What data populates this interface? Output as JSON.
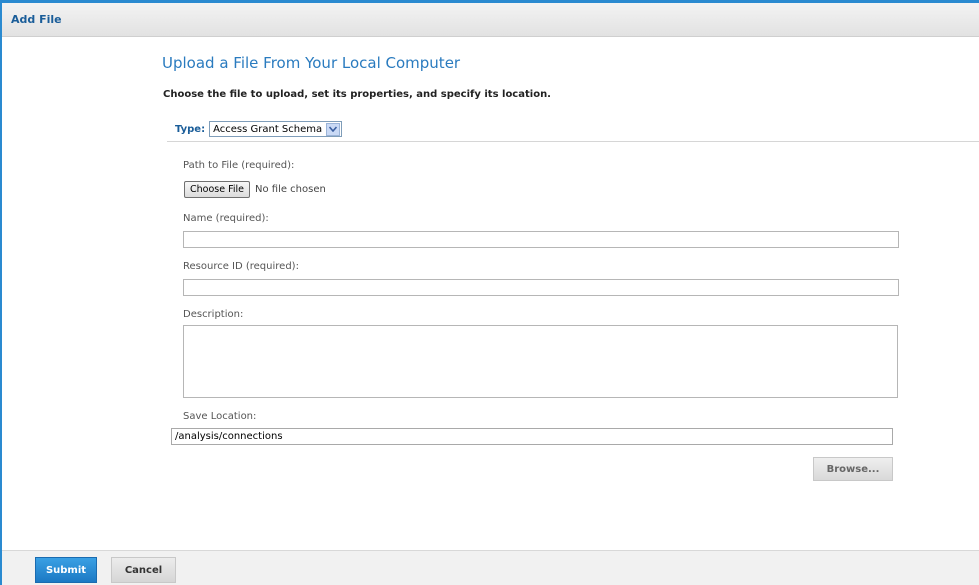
{
  "window": {
    "title": "Add File"
  },
  "main": {
    "heading": "Upload a File From Your Local Computer",
    "instructions": "Choose the file to upload, set its properties, and specify its location."
  },
  "type": {
    "label": "Type:",
    "selected": "Access Grant Schema"
  },
  "fields": {
    "path": {
      "label": "Path to File (required):",
      "button": "Choose File",
      "status": "No file chosen"
    },
    "name": {
      "label": "Name (required):",
      "value": ""
    },
    "resource_id": {
      "label": "Resource ID (required):",
      "value": ""
    },
    "description": {
      "label": "Description:",
      "value": ""
    },
    "save_location": {
      "label": "Save Location:",
      "value": "/analysis/connections"
    }
  },
  "buttons": {
    "browse": "Browse...",
    "submit": "Submit",
    "cancel": "Cancel"
  },
  "colors": {
    "accent": "#2a8ad0",
    "heading": "#2a7bbf",
    "label_blue": "#1a5d99"
  }
}
